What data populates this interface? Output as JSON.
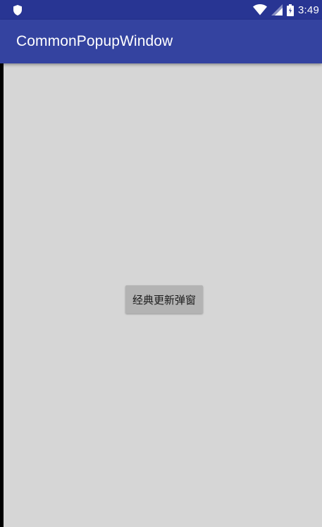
{
  "status_bar": {
    "time": "3:49",
    "icons": [
      "shield-icon",
      "wifi-icon",
      "signal-icon",
      "battery-icon"
    ]
  },
  "app_bar": {
    "title": "CommonPopupWindow"
  },
  "main": {
    "button_label": "经典更新弹窗"
  },
  "colors": {
    "status_bar": "#283593",
    "app_bar": "#3443a0",
    "background": "#d6d6d6",
    "button": "#b3b3b3"
  }
}
